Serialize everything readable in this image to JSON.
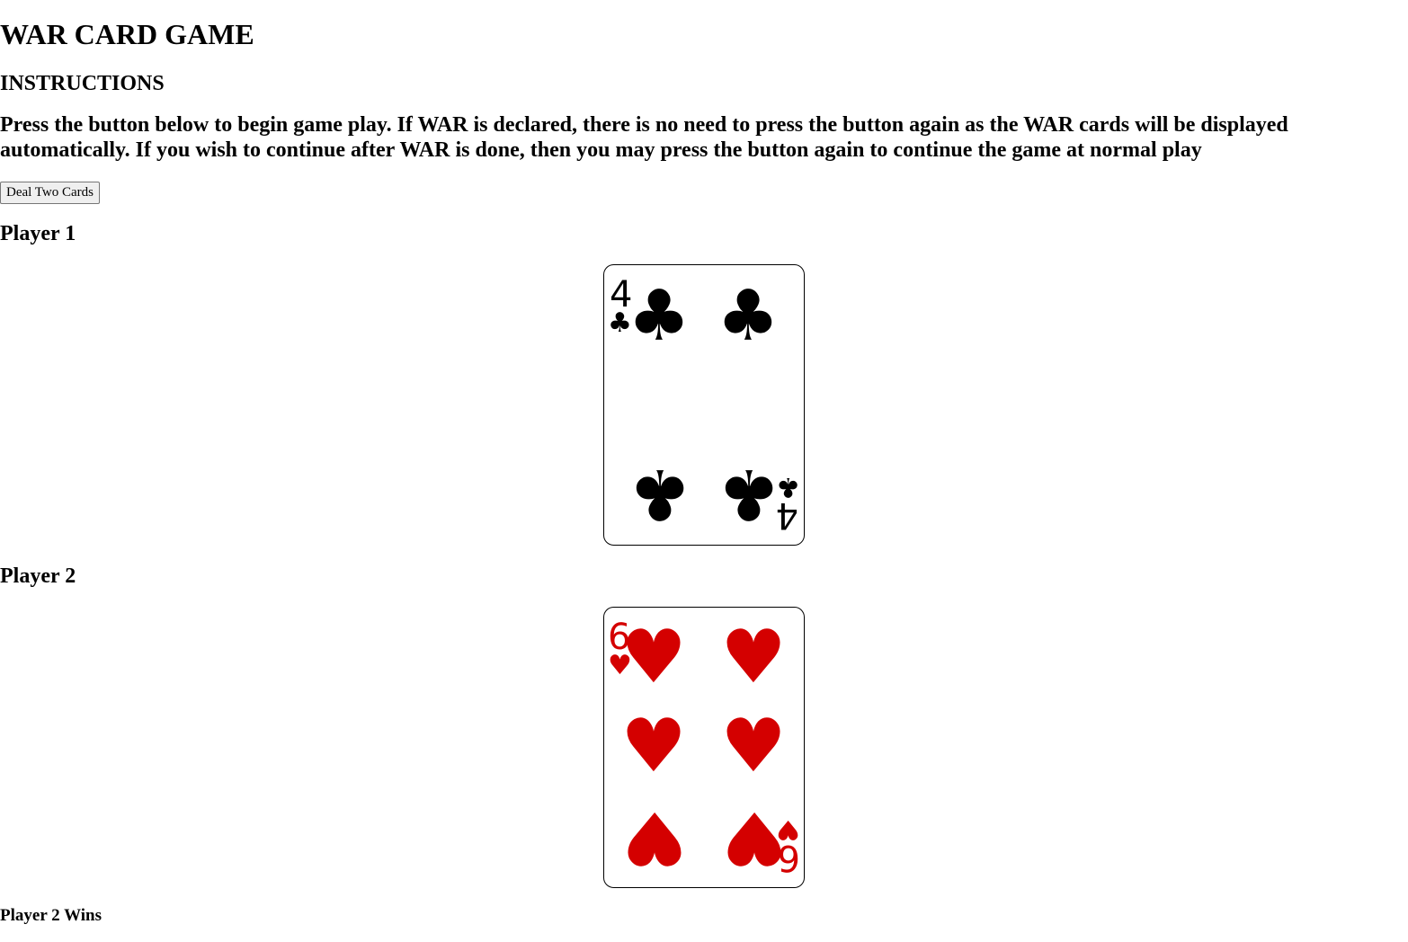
{
  "title": "WAR CARD GAME",
  "instructions": {
    "heading": "INSTRUCTIONS",
    "text": "Press the button below to begin game play. If WAR is declared, there is no need to press the button again as the WAR cards will be displayed automatically. If you wish to continue after WAR is done, then you may press the button again to continue the game at normal play"
  },
  "deal_button_label": "Deal Two Cards",
  "player1": {
    "label": "Player 1",
    "card": {
      "rank": "4",
      "suit": "clubs",
      "suit_symbol": "♣",
      "color": "#000000"
    }
  },
  "player2": {
    "label": "Player 2",
    "card": {
      "rank": "6",
      "suit": "hearts",
      "suit_symbol": "♥",
      "color": "#d40000"
    }
  },
  "result": "Player 2 Wins"
}
